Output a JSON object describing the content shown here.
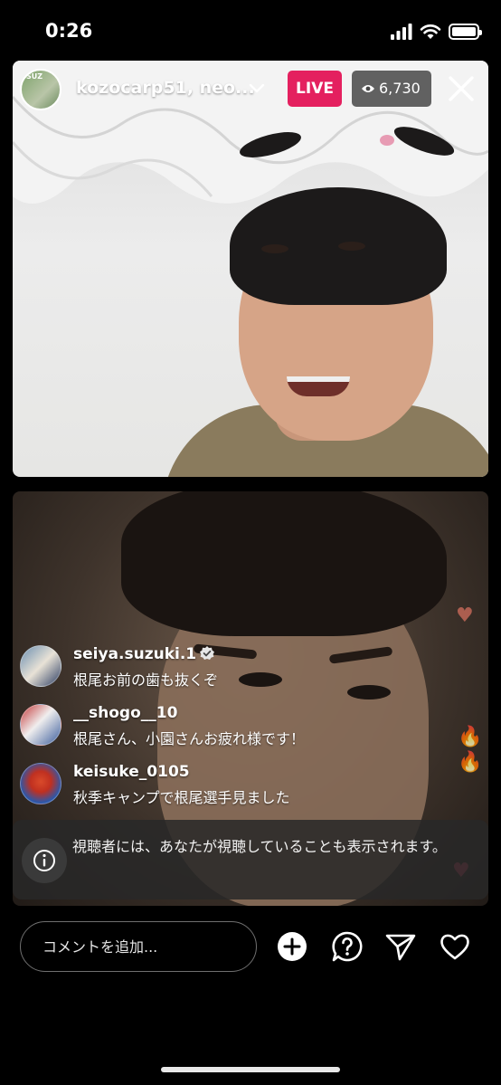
{
  "status_bar": {
    "time": "0:26",
    "icons": [
      "signal-icon",
      "wifi-icon",
      "battery-icon"
    ]
  },
  "header": {
    "host_avatar_text": "SUZ",
    "host_name": "kozocarp51, neo...",
    "live_label": "LIVE",
    "viewer_count": "6,730"
  },
  "comments": [
    {
      "user": "seiya.suzuki.1",
      "verified": true,
      "text": "根尾お前の歯も抜くぞ"
    },
    {
      "user": "__shogo__10",
      "verified": false,
      "text": "根尾さん、小園さんお疲れ様です！"
    },
    {
      "user": "keisuke_0105",
      "verified": false,
      "text": "秋季キャンプで根尾選手見ました"
    }
  ],
  "notice": {
    "text": "視聴者には、あなたが視聴していることも表示されます。"
  },
  "bottom_bar": {
    "comment_placeholder": "コメントを追加..."
  },
  "colors": {
    "live_badge": "#e4205f",
    "background": "#000000"
  }
}
